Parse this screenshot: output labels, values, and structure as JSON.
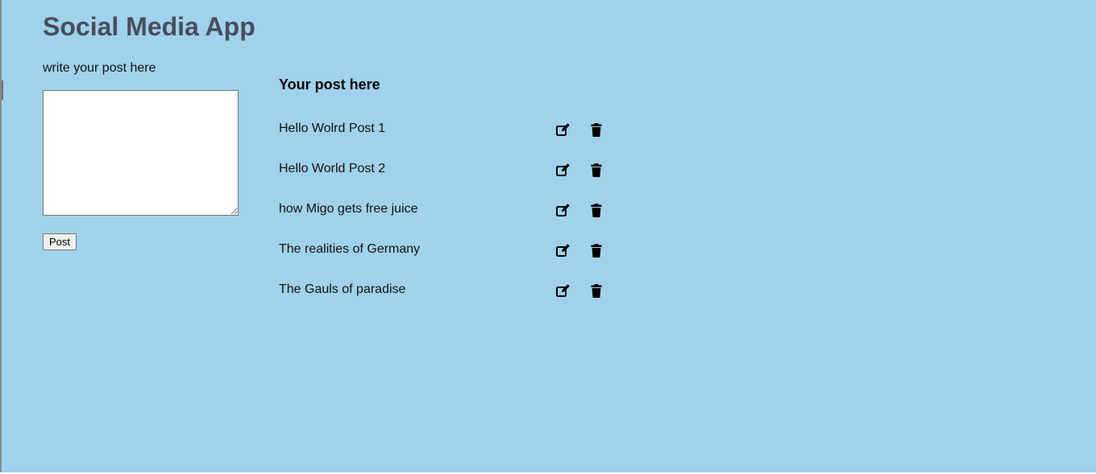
{
  "app": {
    "title": "Social Media App"
  },
  "composer": {
    "label": "write your post here",
    "textarea_value": "",
    "post_button_label": "Post"
  },
  "posts": {
    "heading": "Your post here",
    "items": [
      {
        "text": "Hello Wolrd Post 1",
        "edit_icon": "edit-icon",
        "delete_icon": "trash-icon"
      },
      {
        "text": "Hello World Post 2",
        "edit_icon": "edit-icon",
        "delete_icon": "trash-icon"
      },
      {
        "text": "how Migo gets free juice",
        "edit_icon": "edit-icon",
        "delete_icon": "trash-icon"
      },
      {
        "text": "The realities of Germany",
        "edit_icon": "edit-icon",
        "delete_icon": "trash-icon"
      },
      {
        "text": "The Gauls of paradise",
        "edit_icon": "edit-icon",
        "delete_icon": "trash-icon"
      }
    ]
  },
  "colors": {
    "background": "#a0d2eb",
    "title": "#494d5f",
    "text": "#111111",
    "icons": "#000000"
  }
}
